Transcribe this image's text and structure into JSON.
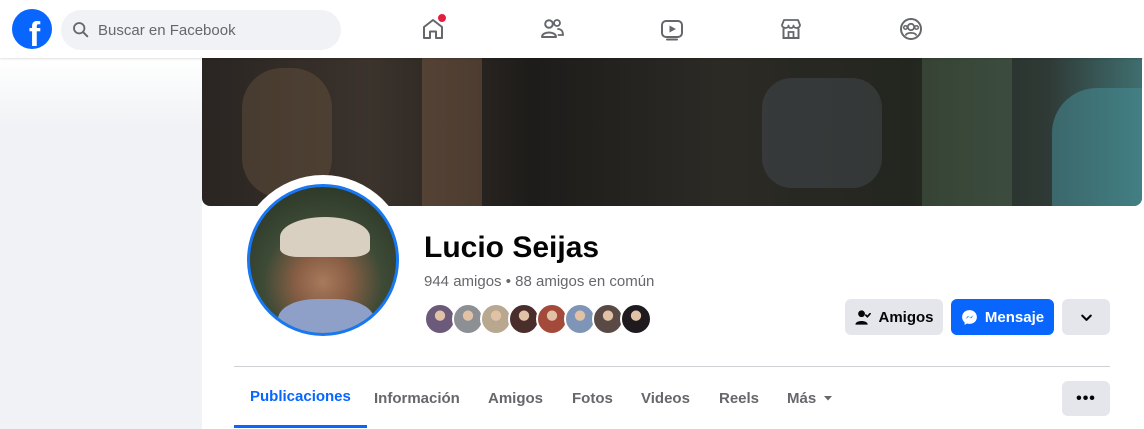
{
  "header": {
    "logo_glyph": "f",
    "search_placeholder": "Buscar en Facebook",
    "nav_icons": [
      "home-icon",
      "friends-icon",
      "video-icon",
      "marketplace-icon",
      "groups-icon"
    ],
    "home_has_notification": true
  },
  "profile": {
    "name": "Lucio Seijas",
    "friends_summary": "944 amigos • 88 amigos en común",
    "mutual_avatar_colors": [
      "#6b5a7a",
      "#8c8f93",
      "#b7a88f",
      "#4a2e2c",
      "#a34a3a",
      "#7f95b8",
      "#5a4a46",
      "#1e1a1e"
    ]
  },
  "actions": {
    "friends_label": "Amigos",
    "message_label": "Mensaje",
    "dropdown_icon": "chevron-down-icon"
  },
  "tabs": {
    "items": [
      "Publicaciones",
      "Información",
      "Amigos",
      "Fotos",
      "Videos",
      "Reels"
    ],
    "more_label": "Más",
    "active": "Publicaciones",
    "overflow_label": "•••"
  },
  "colors": {
    "brand": "#0866ff",
    "text": "#050505",
    "secondary_text": "#65676b",
    "button_gray": "#e4e6eb",
    "notification": "#e41e3f"
  }
}
